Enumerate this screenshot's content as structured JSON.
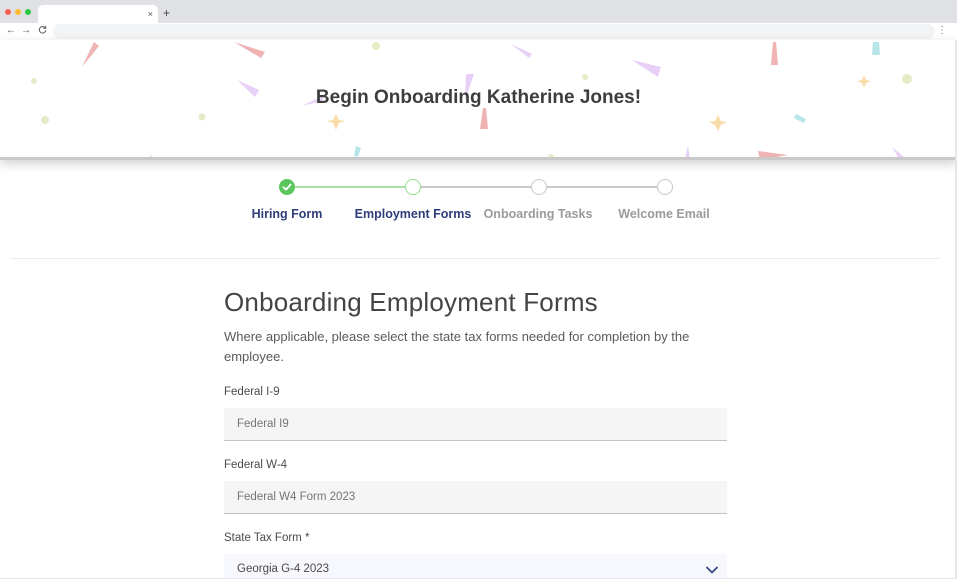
{
  "browser": {
    "tab_close_glyph": "×",
    "new_tab_glyph": "+",
    "back_glyph": "←",
    "forward_glyph": "→",
    "reload_glyph": "C",
    "menu_glyph": "⋮",
    "address": ""
  },
  "banner": {
    "title": "Begin Onboarding Katherine Jones!"
  },
  "stepper": {
    "steps": [
      {
        "label": "Hiring Form",
        "state": "complete"
      },
      {
        "label": "Employment Forms",
        "state": "current"
      },
      {
        "label": "Onboarding Tasks",
        "state": "upcoming"
      },
      {
        "label": "Welcome Email",
        "state": "upcoming"
      }
    ],
    "colors": {
      "complete": "#5cc65c",
      "active_label": "#2f3d7a",
      "inactive_label": "#9a9a9a"
    }
  },
  "form": {
    "title": "Onboarding Employment Forms",
    "description": "Where applicable, please select the state tax forms needed for completion by the employee.",
    "fields": [
      {
        "label": "Federal I-9",
        "placeholder": "Federal I9",
        "value": ""
      },
      {
        "label": "Federal W-4",
        "placeholder": "Federal W4 Form 2023",
        "value": ""
      },
      {
        "label": "State Tax Form *",
        "value": "Georgia G-4 2023"
      }
    ]
  }
}
